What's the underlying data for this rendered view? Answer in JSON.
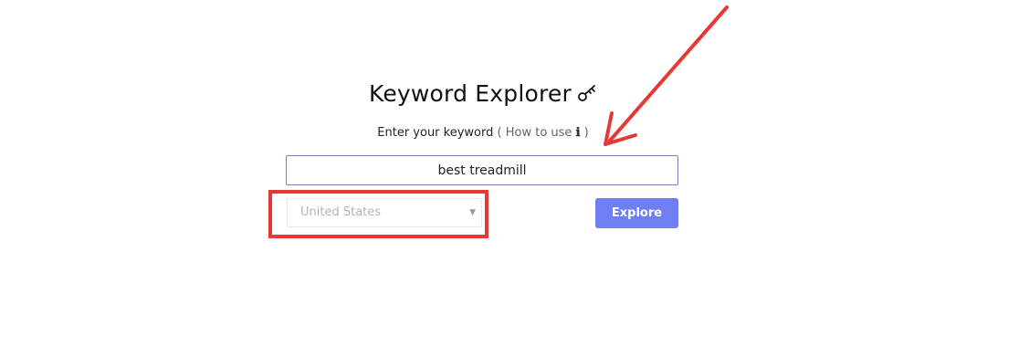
{
  "page": {
    "title": "Keyword Explorer",
    "title_icon": "key-icon"
  },
  "form": {
    "prompt": "Enter your keyword",
    "howto_open": "(",
    "howto_label": "How to use",
    "howto_icon": "ℹ",
    "howto_close": ")",
    "keyword_value": "best treadmill",
    "country_selected": "United States",
    "explore_label": "Explore"
  },
  "annotations": {
    "arrow_color": "#e53935",
    "highlight_color": "#e53935"
  },
  "colors": {
    "button": "#6f7ef0",
    "input_border": "#7a80b8"
  }
}
